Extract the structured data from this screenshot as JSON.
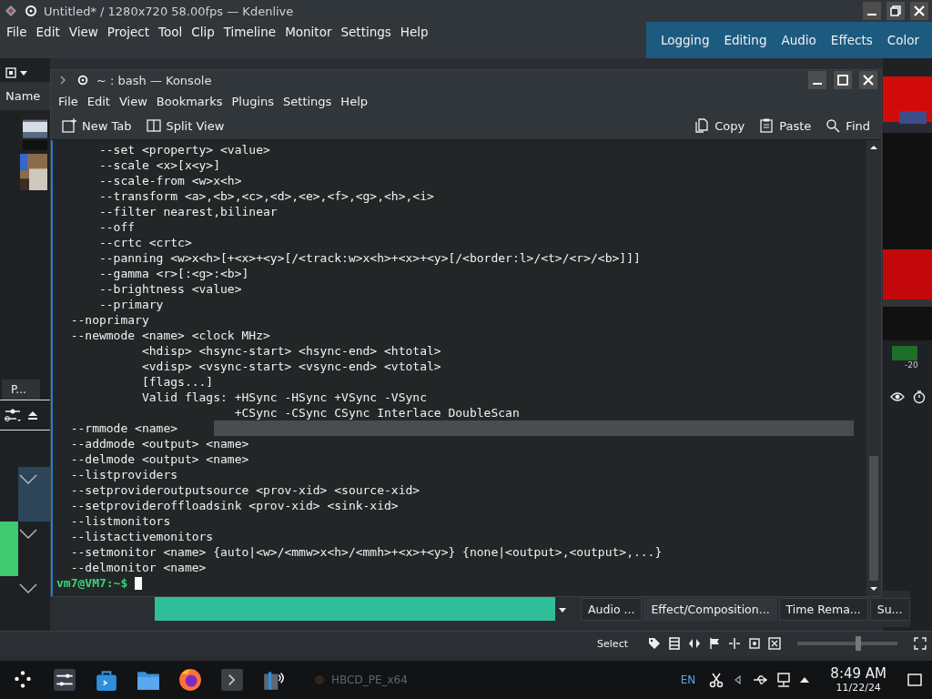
{
  "kdenlive": {
    "title": "Untitled* / 1280x720 58.00fps — Kdenlive",
    "menu": [
      "File",
      "Edit",
      "View",
      "Project",
      "Tool",
      "Clip",
      "Timeline",
      "Monitor",
      "Settings",
      "Help"
    ],
    "workspaces": [
      "Logging",
      "Editing",
      "Audio",
      "Effects",
      "Color"
    ],
    "bin_header": "Name",
    "panel_tab": "P...",
    "meter_label": "-20",
    "dock_tabs": [
      {
        "label": "Audio ...",
        "selected": false
      },
      {
        "label": "Effect/Composition...",
        "selected": true
      },
      {
        "label": "Time Rema...",
        "selected": false
      },
      {
        "label": "Su...",
        "selected": false
      }
    ],
    "status_mode": "Select",
    "zoom": {
      "level": 0.62
    }
  },
  "konsole": {
    "title": "~ : bash — Konsole",
    "menu": [
      "File",
      "Edit",
      "View",
      "Bookmarks",
      "Plugins",
      "Settings",
      "Help"
    ],
    "toolbar": {
      "new_tab": "New Tab",
      "split_view": "Split View",
      "copy": "Copy",
      "paste": "Paste",
      "find": "Find"
    },
    "lines": [
      {
        "text": "      --set <property> <value>",
        "highlighted": false
      },
      {
        "text": "      --scale <x>[x<y>]",
        "highlighted": false
      },
      {
        "text": "      --scale-from <w>x<h>",
        "highlighted": false
      },
      {
        "text": "      --transform <a>,<b>,<c>,<d>,<e>,<f>,<g>,<h>,<i>",
        "highlighted": false
      },
      {
        "text": "      --filter nearest,bilinear",
        "highlighted": false
      },
      {
        "text": "      --off",
        "highlighted": false
      },
      {
        "text": "      --crtc <crtc>",
        "highlighted": false
      },
      {
        "text": "      --panning <w>x<h>[+<x>+<y>[/<track:w>x<h>+<x>+<y>[/<border:l>/<t>/<r>/<b>]]]",
        "highlighted": false
      },
      {
        "text": "      --gamma <r>[:<g>:<b>]",
        "highlighted": false
      },
      {
        "text": "      --brightness <value>",
        "highlighted": false
      },
      {
        "text": "      --primary",
        "highlighted": false
      },
      {
        "text": "  --noprimary",
        "highlighted": false
      },
      {
        "text": "  --newmode <name> <clock MHz>",
        "highlighted": false
      },
      {
        "text": "            <hdisp> <hsync-start> <hsync-end> <htotal>",
        "highlighted": false
      },
      {
        "text": "            <vdisp> <vsync-start> <vsync-end> <vtotal>",
        "highlighted": false
      },
      {
        "text": "            [flags...]",
        "highlighted": false
      },
      {
        "text": "            Valid flags: +HSync -HSync +VSync -VSync",
        "highlighted": false
      },
      {
        "text": "                         +CSync -CSync CSync Interlace DoubleScan",
        "highlighted": false
      },
      {
        "text": "  --rmmode <name>",
        "highlighted": true
      },
      {
        "text": "  --addmode <output> <name>",
        "highlighted": false
      },
      {
        "text": "  --delmode <output> <name>",
        "highlighted": false
      },
      {
        "text": "  --listproviders",
        "highlighted": false
      },
      {
        "text": "  --setprovideroutputsource <prov-xid> <source-xid>",
        "highlighted": false
      },
      {
        "text": "  --setprovideroffloadsink <prov-xid> <sink-xid>",
        "highlighted": false
      },
      {
        "text": "  --listmonitors",
        "highlighted": false
      },
      {
        "text": "  --listactivemonitors",
        "highlighted": false
      },
      {
        "text": "  --setmonitor <name> {auto|<w>/<mmw>x<h>/<mmh>+<x>+<y>} {none|<output>,<output>,...}",
        "highlighted": false
      },
      {
        "text": "  --delmonitor <name>",
        "highlighted": false
      }
    ],
    "prompt": "vm7@VM7:~$"
  },
  "taskbar": {
    "background_task": "HBCD_PE_x64",
    "language": "EN",
    "time": "8:49 AM",
    "date": "11/22/24"
  }
}
